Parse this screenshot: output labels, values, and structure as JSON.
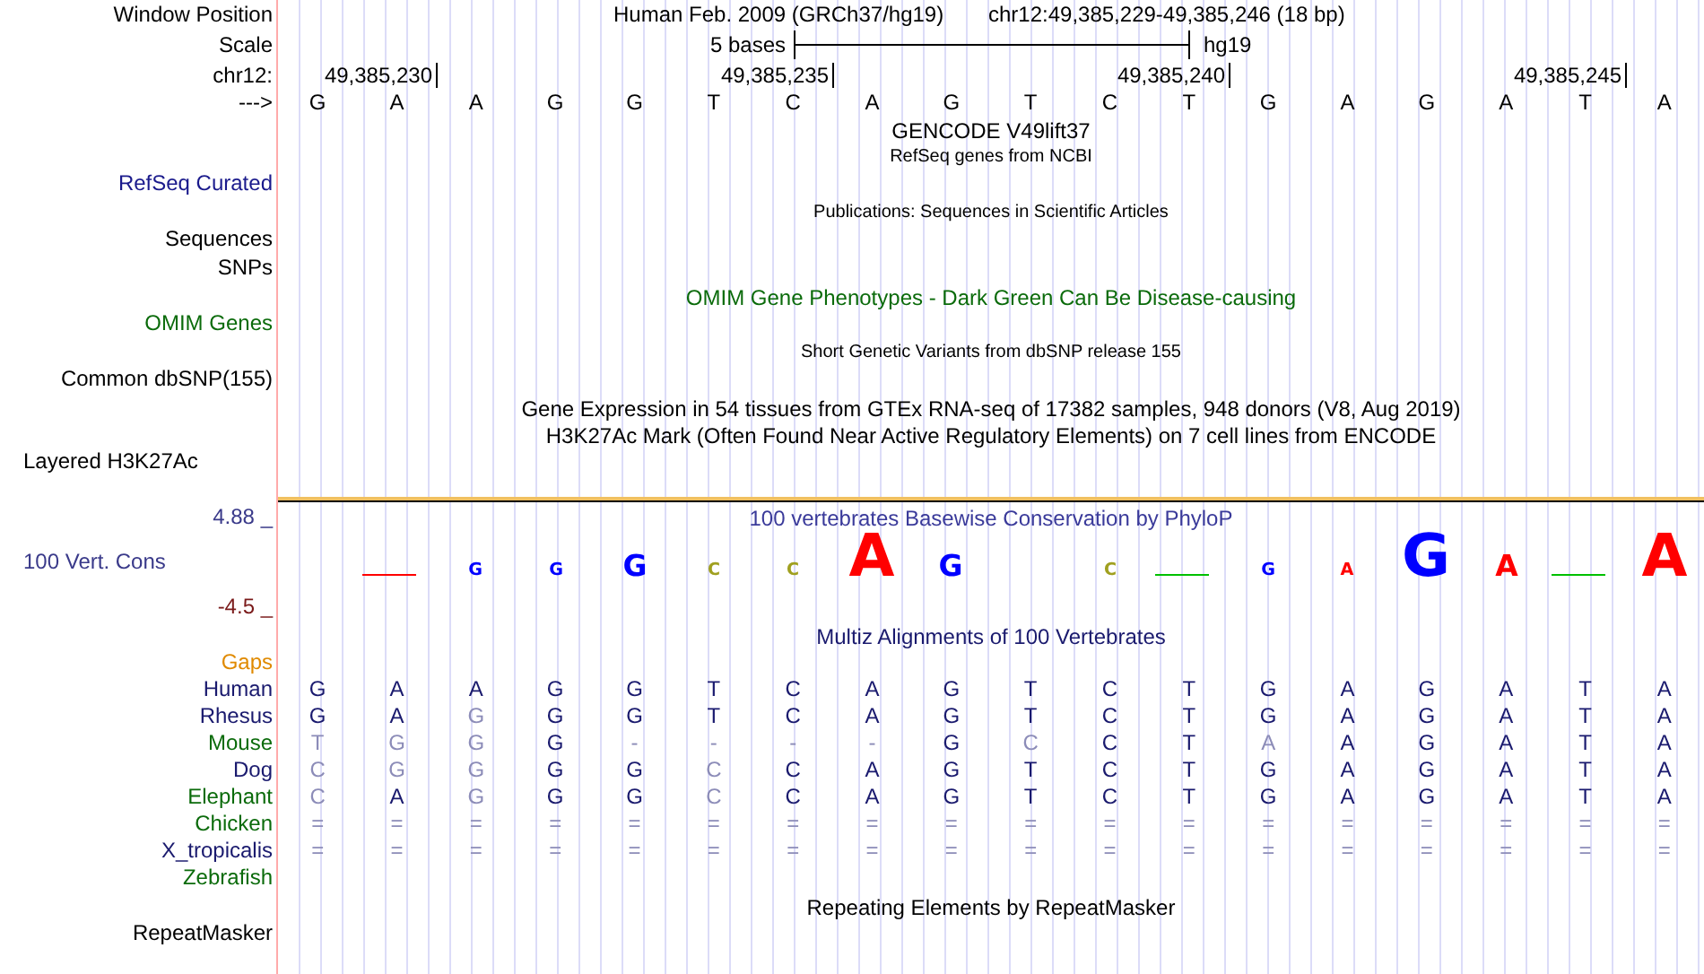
{
  "header": {
    "label_position": "Window Position",
    "assembly_title": "Human Feb. 2009 (GRCh37/hg19)",
    "position": "chr12:49,385,229-49,385,246 (18 bp)",
    "label_scale": "Scale",
    "scale_text": "5 bases",
    "scale_db": "hg19",
    "label_chrom": "chr12:",
    "label_strand": "--->"
  },
  "ruler_ticks": [
    {
      "label": "49,385,230"
    },
    {
      "label": "49,385,235"
    },
    {
      "label": "49,385,240"
    },
    {
      "label": "49,385,245"
    }
  ],
  "bases": [
    "G",
    "A",
    "A",
    "G",
    "G",
    "T",
    "C",
    "A",
    "G",
    "T",
    "C",
    "T",
    "G",
    "A",
    "G",
    "A",
    "T",
    "A"
  ],
  "track_labels": [
    {
      "text": "RefSeq Curated",
      "color": "#1a1a8c"
    },
    {
      "text": "Sequences",
      "color": "#000000"
    },
    {
      "text": "SNPs",
      "color": "#000000"
    },
    {
      "text": "OMIM Genes",
      "color": "#0b6b0b"
    },
    {
      "text": "Common dbSNP(155)",
      "color": "#000000"
    },
    {
      "text": "Layered H3K27Ac",
      "color": "#000000"
    },
    {
      "text": "100 Vert. Cons",
      "color": "#3a3a8a"
    },
    {
      "text": "Gaps",
      "color": "#e08a00"
    },
    {
      "text": "RepeatMasker",
      "color": "#000000"
    }
  ],
  "track_captions": [
    {
      "text": "GENCODE V49lift37",
      "kind": "normal",
      "color": "#000000"
    },
    {
      "text": "RefSeq genes from NCBI",
      "kind": "small",
      "color": "#000000"
    },
    {
      "text": "Publications: Sequences in Scientific Articles",
      "kind": "small",
      "color": "#000000"
    },
    {
      "text": "OMIM Gene Phenotypes - Dark Green Can Be Disease-causing",
      "kind": "normal",
      "color": "#0b6b0b"
    },
    {
      "text": "Short Genetic Variants from dbSNP release 155",
      "kind": "small",
      "color": "#000000"
    },
    {
      "text": "Gene Expression in 54 tissues from GTEx RNA-seq of 17382 samples, 948 donors (V8, Aug 2019)",
      "kind": "normal",
      "color": "#000000"
    },
    {
      "text": "H3K27Ac Mark (Often Found Near Active Regulatory Elements) on 7 cell lines from ENCODE",
      "kind": "normal",
      "color": "#000000"
    },
    {
      "text": "100 vertebrates Basewise Conservation by PhyloP",
      "kind": "normal",
      "color": "#3a3a9a"
    },
    {
      "text": "Multiz Alignments of 100 Vertebrates",
      "kind": "normal",
      "color": "#1a1a6e"
    },
    {
      "text": "Repeating Elements by RepeatMasker",
      "kind": "normal",
      "color": "#000000"
    }
  ],
  "conservation": {
    "max_label": "4.88 _",
    "min_label": "-4.5 _",
    "logo": [
      {
        "kind": "none"
      },
      {
        "kind": "dash",
        "color": "#ff0000"
      },
      {
        "kind": "small",
        "letter": "G",
        "color": "#0000ff"
      },
      {
        "kind": "small",
        "letter": "G",
        "color": "#0000ff"
      },
      {
        "kind": "medium",
        "letter": "G",
        "color": "#0000ff"
      },
      {
        "kind": "small",
        "letter": "C",
        "color": "#a0a020"
      },
      {
        "kind": "small",
        "letter": "C",
        "color": "#a0a020"
      },
      {
        "kind": "large",
        "letter": "A",
        "color": "#ff0000"
      },
      {
        "kind": "medium",
        "letter": "G",
        "color": "#0000ff"
      },
      {
        "kind": "none"
      },
      {
        "kind": "small",
        "letter": "C",
        "color": "#a0a020"
      },
      {
        "kind": "dash",
        "color": "#00c000"
      },
      {
        "kind": "small",
        "letter": "G",
        "color": "#0000ff"
      },
      {
        "kind": "small",
        "letter": "A",
        "color": "#ff0000"
      },
      {
        "kind": "large",
        "letter": "G",
        "color": "#0000ff"
      },
      {
        "kind": "medium",
        "letter": "A",
        "color": "#ff0000"
      },
      {
        "kind": "dash",
        "color": "#00c000"
      },
      {
        "kind": "large",
        "letter": "A",
        "color": "#ff0000"
      }
    ]
  },
  "alignment": {
    "rows": [
      {
        "species": "Human",
        "color": "#1a1a6e",
        "cells": [
          {
            "base": "G",
            "faded": false
          },
          {
            "base": "A",
            "faded": false
          },
          {
            "base": "A",
            "faded": false
          },
          {
            "base": "G",
            "faded": false
          },
          {
            "base": "G",
            "faded": false
          },
          {
            "base": "T",
            "faded": false
          },
          {
            "base": "C",
            "faded": false
          },
          {
            "base": "A",
            "faded": false
          },
          {
            "base": "G",
            "faded": false
          },
          {
            "base": "T",
            "faded": false
          },
          {
            "base": "C",
            "faded": false
          },
          {
            "base": "T",
            "faded": false
          },
          {
            "base": "G",
            "faded": false
          },
          {
            "base": "A",
            "faded": false
          },
          {
            "base": "G",
            "faded": false
          },
          {
            "base": "A",
            "faded": false
          },
          {
            "base": "T",
            "faded": false
          },
          {
            "base": "A",
            "faded": false
          }
        ]
      },
      {
        "species": "Rhesus",
        "color": "#1a1a6e",
        "cells": [
          {
            "base": "G",
            "faded": false
          },
          {
            "base": "A",
            "faded": false
          },
          {
            "base": "G",
            "faded": true
          },
          {
            "base": "G",
            "faded": false
          },
          {
            "base": "G",
            "faded": false
          },
          {
            "base": "T",
            "faded": false
          },
          {
            "base": "C",
            "faded": false
          },
          {
            "base": "A",
            "faded": false
          },
          {
            "base": "G",
            "faded": false
          },
          {
            "base": "T",
            "faded": false
          },
          {
            "base": "C",
            "faded": false
          },
          {
            "base": "T",
            "faded": false
          },
          {
            "base": "G",
            "faded": false
          },
          {
            "base": "A",
            "faded": false
          },
          {
            "base": "G",
            "faded": false
          },
          {
            "base": "A",
            "faded": false
          },
          {
            "base": "T",
            "faded": false
          },
          {
            "base": "A",
            "faded": false
          }
        ]
      },
      {
        "species": "Mouse",
        "color": "#0b6b0b",
        "cells": [
          {
            "base": "T",
            "faded": true
          },
          {
            "base": "G",
            "faded": true
          },
          {
            "base": "G",
            "faded": true
          },
          {
            "base": "G",
            "faded": false
          },
          {
            "base": "-",
            "faded": true
          },
          {
            "base": "-",
            "faded": true
          },
          {
            "base": "-",
            "faded": true
          },
          {
            "base": "-",
            "faded": true
          },
          {
            "base": "G",
            "faded": false
          },
          {
            "base": "C",
            "faded": true
          },
          {
            "base": "C",
            "faded": false
          },
          {
            "base": "T",
            "faded": false
          },
          {
            "base": "A",
            "faded": true
          },
          {
            "base": "A",
            "faded": false
          },
          {
            "base": "G",
            "faded": false
          },
          {
            "base": "A",
            "faded": false
          },
          {
            "base": "T",
            "faded": false
          },
          {
            "base": "A",
            "faded": false
          }
        ]
      },
      {
        "species": "Dog",
        "color": "#1a1a6e",
        "cells": [
          {
            "base": "C",
            "faded": true
          },
          {
            "base": "G",
            "faded": true
          },
          {
            "base": "G",
            "faded": true
          },
          {
            "base": "G",
            "faded": false
          },
          {
            "base": "G",
            "faded": false
          },
          {
            "base": "C",
            "faded": true
          },
          {
            "base": "C",
            "faded": false
          },
          {
            "base": "A",
            "faded": false
          },
          {
            "base": "G",
            "faded": false
          },
          {
            "base": "T",
            "faded": false
          },
          {
            "base": "C",
            "faded": false
          },
          {
            "base": "T",
            "faded": false
          },
          {
            "base": "G",
            "faded": false
          },
          {
            "base": "A",
            "faded": false
          },
          {
            "base": "G",
            "faded": false
          },
          {
            "base": "A",
            "faded": false
          },
          {
            "base": "T",
            "faded": false
          },
          {
            "base": "A",
            "faded": false
          }
        ]
      },
      {
        "species": "Elephant",
        "color": "#0b6b0b",
        "cells": [
          {
            "base": "C",
            "faded": true
          },
          {
            "base": "A",
            "faded": false
          },
          {
            "base": "G",
            "faded": true
          },
          {
            "base": "G",
            "faded": false
          },
          {
            "base": "G",
            "faded": false
          },
          {
            "base": "C",
            "faded": true
          },
          {
            "base": "C",
            "faded": false
          },
          {
            "base": "A",
            "faded": false
          },
          {
            "base": "G",
            "faded": false
          },
          {
            "base": "T",
            "faded": false
          },
          {
            "base": "C",
            "faded": false
          },
          {
            "base": "T",
            "faded": false
          },
          {
            "base": "G",
            "faded": false
          },
          {
            "base": "A",
            "faded": false
          },
          {
            "base": "G",
            "faded": false
          },
          {
            "base": "A",
            "faded": false
          },
          {
            "base": "T",
            "faded": false
          },
          {
            "base": "A",
            "faded": false
          }
        ]
      },
      {
        "species": "Chicken",
        "color": "#0b6b0b",
        "cells": [
          {
            "base": "=",
            "faded": true
          },
          {
            "base": "=",
            "faded": true
          },
          {
            "base": "=",
            "faded": true
          },
          {
            "base": "=",
            "faded": true
          },
          {
            "base": "=",
            "faded": true
          },
          {
            "base": "=",
            "faded": true
          },
          {
            "base": "=",
            "faded": true
          },
          {
            "base": "=",
            "faded": true
          },
          {
            "base": "=",
            "faded": true
          },
          {
            "base": "=",
            "faded": true
          },
          {
            "base": "=",
            "faded": true
          },
          {
            "base": "=",
            "faded": true
          },
          {
            "base": "=",
            "faded": true
          },
          {
            "base": "=",
            "faded": true
          },
          {
            "base": "=",
            "faded": true
          },
          {
            "base": "=",
            "faded": true
          },
          {
            "base": "=",
            "faded": true
          },
          {
            "base": "=",
            "faded": true
          }
        ]
      },
      {
        "species": "X_tropicalis",
        "color": "#1a1a6e",
        "cells": [
          {
            "base": "=",
            "faded": true
          },
          {
            "base": "=",
            "faded": true
          },
          {
            "base": "=",
            "faded": true
          },
          {
            "base": "=",
            "faded": true
          },
          {
            "base": "=",
            "faded": true
          },
          {
            "base": "=",
            "faded": true
          },
          {
            "base": "=",
            "faded": true
          },
          {
            "base": "=",
            "faded": true
          },
          {
            "base": "=",
            "faded": true
          },
          {
            "base": "=",
            "faded": true
          },
          {
            "base": "=",
            "faded": true
          },
          {
            "base": "=",
            "faded": true
          },
          {
            "base": "=",
            "faded": true
          },
          {
            "base": "=",
            "faded": true
          },
          {
            "base": "=",
            "faded": true
          },
          {
            "base": "=",
            "faded": true
          },
          {
            "base": "=",
            "faded": true
          },
          {
            "base": "=",
            "faded": true
          }
        ]
      },
      {
        "species": "Zebrafish",
        "color": "#0b6b0b",
        "cells": []
      }
    ]
  }
}
